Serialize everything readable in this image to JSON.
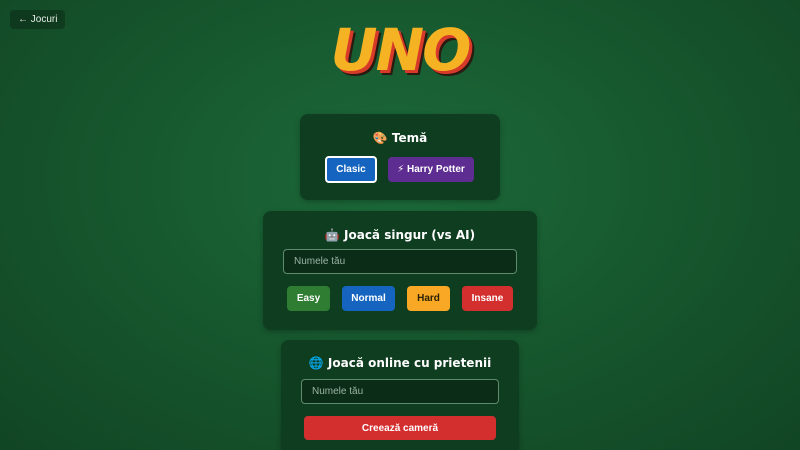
{
  "nav": {
    "back_label": "← Jocuri"
  },
  "logo": {
    "text": "UNO"
  },
  "theme": {
    "icon": "palette-icon",
    "title": "🎨 Temă",
    "options": [
      {
        "label": "Clasic",
        "selected": true,
        "color": "#1565c0"
      },
      {
        "label": "⚡ Harry Potter",
        "selected": false,
        "color": "#5e2d91"
      }
    ]
  },
  "solo": {
    "icon": "robot-icon",
    "title": "🤖 Joacă singur (vs AI)",
    "name_placeholder": "Numele tău",
    "name_value": "",
    "difficulties": [
      {
        "label": "Easy",
        "color": "#2e7d32"
      },
      {
        "label": "Normal",
        "color": "#1565c0"
      },
      {
        "label": "Hard",
        "color": "#f9a825"
      },
      {
        "label": "Insane",
        "color": "#d32f2f"
      }
    ]
  },
  "online": {
    "icon": "globe-icon",
    "title": "🌐 Joacă online cu prietenii",
    "name_placeholder": "Numele tău",
    "name_value": "",
    "create_room_label": "Creează cameră",
    "create_room_color": "#d32f2f"
  }
}
